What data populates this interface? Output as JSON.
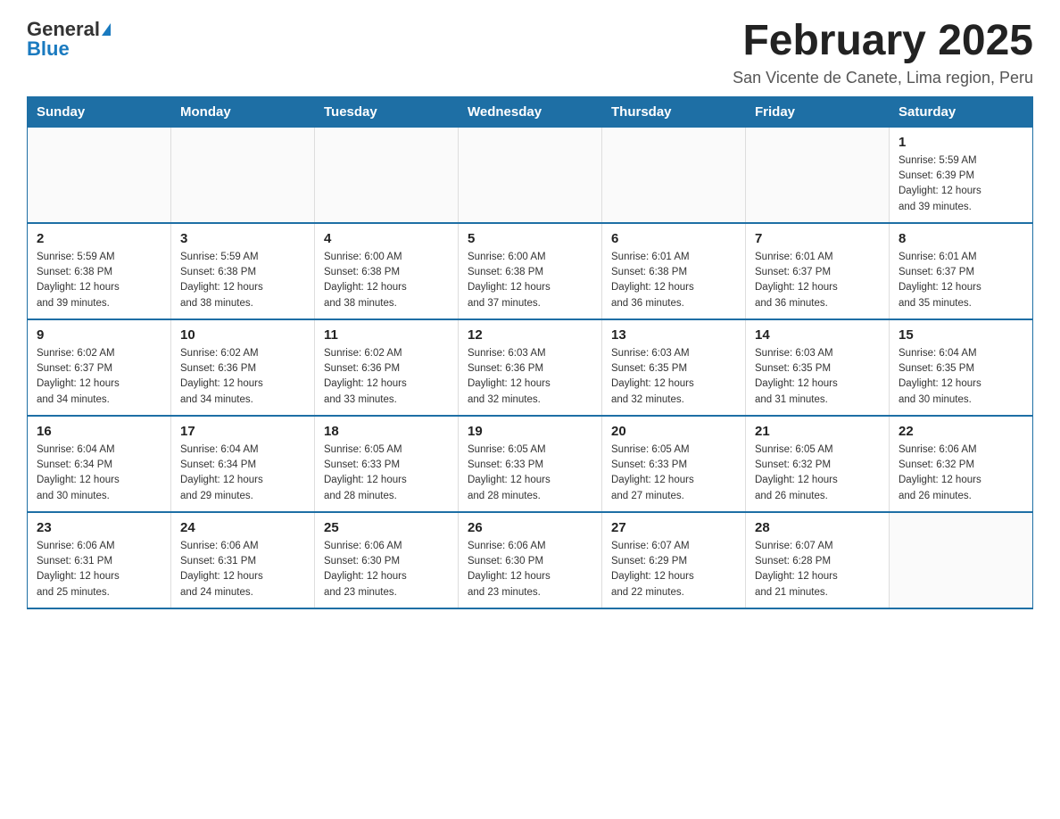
{
  "header": {
    "logo_general": "General",
    "logo_blue": "Blue",
    "month_title": "February 2025",
    "location": "San Vicente de Canete, Lima region, Peru"
  },
  "weekdays": [
    "Sunday",
    "Monday",
    "Tuesday",
    "Wednesday",
    "Thursday",
    "Friday",
    "Saturday"
  ],
  "weeks": [
    [
      {
        "day": "",
        "info": ""
      },
      {
        "day": "",
        "info": ""
      },
      {
        "day": "",
        "info": ""
      },
      {
        "day": "",
        "info": ""
      },
      {
        "day": "",
        "info": ""
      },
      {
        "day": "",
        "info": ""
      },
      {
        "day": "1",
        "info": "Sunrise: 5:59 AM\nSunset: 6:39 PM\nDaylight: 12 hours\nand 39 minutes."
      }
    ],
    [
      {
        "day": "2",
        "info": "Sunrise: 5:59 AM\nSunset: 6:38 PM\nDaylight: 12 hours\nand 39 minutes."
      },
      {
        "day": "3",
        "info": "Sunrise: 5:59 AM\nSunset: 6:38 PM\nDaylight: 12 hours\nand 38 minutes."
      },
      {
        "day": "4",
        "info": "Sunrise: 6:00 AM\nSunset: 6:38 PM\nDaylight: 12 hours\nand 38 minutes."
      },
      {
        "day": "5",
        "info": "Sunrise: 6:00 AM\nSunset: 6:38 PM\nDaylight: 12 hours\nand 37 minutes."
      },
      {
        "day": "6",
        "info": "Sunrise: 6:01 AM\nSunset: 6:38 PM\nDaylight: 12 hours\nand 36 minutes."
      },
      {
        "day": "7",
        "info": "Sunrise: 6:01 AM\nSunset: 6:37 PM\nDaylight: 12 hours\nand 36 minutes."
      },
      {
        "day": "8",
        "info": "Sunrise: 6:01 AM\nSunset: 6:37 PM\nDaylight: 12 hours\nand 35 minutes."
      }
    ],
    [
      {
        "day": "9",
        "info": "Sunrise: 6:02 AM\nSunset: 6:37 PM\nDaylight: 12 hours\nand 34 minutes."
      },
      {
        "day": "10",
        "info": "Sunrise: 6:02 AM\nSunset: 6:36 PM\nDaylight: 12 hours\nand 34 minutes."
      },
      {
        "day": "11",
        "info": "Sunrise: 6:02 AM\nSunset: 6:36 PM\nDaylight: 12 hours\nand 33 minutes."
      },
      {
        "day": "12",
        "info": "Sunrise: 6:03 AM\nSunset: 6:36 PM\nDaylight: 12 hours\nand 32 minutes."
      },
      {
        "day": "13",
        "info": "Sunrise: 6:03 AM\nSunset: 6:35 PM\nDaylight: 12 hours\nand 32 minutes."
      },
      {
        "day": "14",
        "info": "Sunrise: 6:03 AM\nSunset: 6:35 PM\nDaylight: 12 hours\nand 31 minutes."
      },
      {
        "day": "15",
        "info": "Sunrise: 6:04 AM\nSunset: 6:35 PM\nDaylight: 12 hours\nand 30 minutes."
      }
    ],
    [
      {
        "day": "16",
        "info": "Sunrise: 6:04 AM\nSunset: 6:34 PM\nDaylight: 12 hours\nand 30 minutes."
      },
      {
        "day": "17",
        "info": "Sunrise: 6:04 AM\nSunset: 6:34 PM\nDaylight: 12 hours\nand 29 minutes."
      },
      {
        "day": "18",
        "info": "Sunrise: 6:05 AM\nSunset: 6:33 PM\nDaylight: 12 hours\nand 28 minutes."
      },
      {
        "day": "19",
        "info": "Sunrise: 6:05 AM\nSunset: 6:33 PM\nDaylight: 12 hours\nand 28 minutes."
      },
      {
        "day": "20",
        "info": "Sunrise: 6:05 AM\nSunset: 6:33 PM\nDaylight: 12 hours\nand 27 minutes."
      },
      {
        "day": "21",
        "info": "Sunrise: 6:05 AM\nSunset: 6:32 PM\nDaylight: 12 hours\nand 26 minutes."
      },
      {
        "day": "22",
        "info": "Sunrise: 6:06 AM\nSunset: 6:32 PM\nDaylight: 12 hours\nand 26 minutes."
      }
    ],
    [
      {
        "day": "23",
        "info": "Sunrise: 6:06 AM\nSunset: 6:31 PM\nDaylight: 12 hours\nand 25 minutes."
      },
      {
        "day": "24",
        "info": "Sunrise: 6:06 AM\nSunset: 6:31 PM\nDaylight: 12 hours\nand 24 minutes."
      },
      {
        "day": "25",
        "info": "Sunrise: 6:06 AM\nSunset: 6:30 PM\nDaylight: 12 hours\nand 23 minutes."
      },
      {
        "day": "26",
        "info": "Sunrise: 6:06 AM\nSunset: 6:30 PM\nDaylight: 12 hours\nand 23 minutes."
      },
      {
        "day": "27",
        "info": "Sunrise: 6:07 AM\nSunset: 6:29 PM\nDaylight: 12 hours\nand 22 minutes."
      },
      {
        "day": "28",
        "info": "Sunrise: 6:07 AM\nSunset: 6:28 PM\nDaylight: 12 hours\nand 21 minutes."
      },
      {
        "day": "",
        "info": ""
      }
    ]
  ]
}
